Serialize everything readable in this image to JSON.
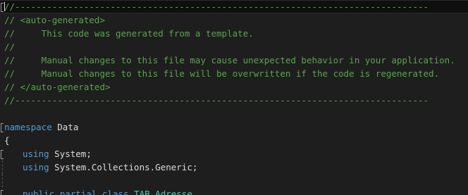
{
  "editor": {
    "line1": "//------------------------------------------------------------------------------",
    "line2": "// <auto-generated>",
    "line3": "//     This code was generated from a template.",
    "line4": "//",
    "line5": "//     Manual changes to this file may cause unexpected behavior in your application.",
    "line6": "//     Manual changes to this file will be overwritten if the code is regenerated.",
    "line7": "// </auto-generated>",
    "line8": "//------------------------------------------------------------------------------",
    "ns_keyword": "namespace",
    "ns_name": "Data",
    "brace_open": "{",
    "using1_keyword": "using",
    "using1_name": "System;",
    "using2_keyword": "using",
    "using2_name": "System.Collections.Generic;",
    "class_public": "public",
    "class_partial": "partial",
    "class_keyword": "class",
    "class_name": "TAB_Adresse"
  }
}
